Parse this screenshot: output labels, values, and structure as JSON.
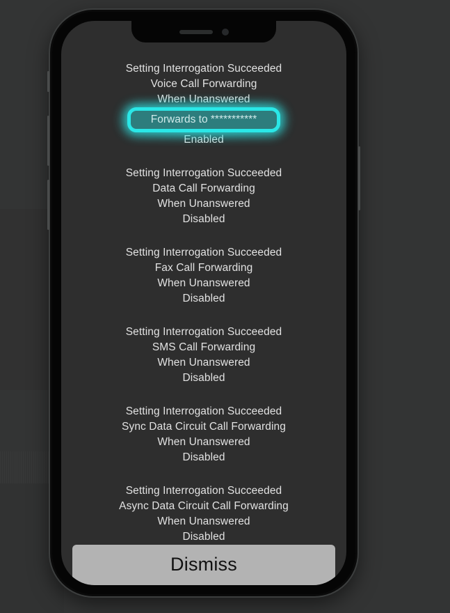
{
  "device": {
    "type": "smartphone",
    "notch": {
      "speaker": "earpiece-speaker",
      "camera": "front-camera"
    },
    "buttons": [
      "mute-switch",
      "volume-up",
      "volume-down",
      "power"
    ]
  },
  "alert": {
    "blocks": [
      {
        "title": "Setting Interrogation Succeeded",
        "service": "Voice Call Forwarding",
        "condition": "When Unanswered",
        "detail": "Forwards to ***********",
        "detail_label": "Forwards to",
        "detail_value": "***********",
        "status": "Enabled",
        "highlighted": true
      },
      {
        "title": "Setting Interrogation Succeeded",
        "service": "Data Call Forwarding",
        "condition": "When Unanswered",
        "status": "Disabled",
        "highlighted": false
      },
      {
        "title": "Setting Interrogation Succeeded",
        "service": "Fax Call Forwarding",
        "condition": "When Unanswered",
        "status": "Disabled",
        "highlighted": false
      },
      {
        "title": "Setting Interrogation Succeeded",
        "service": "SMS Call Forwarding",
        "condition": "When Unanswered",
        "status": "Disabled",
        "highlighted": false
      },
      {
        "title": "Setting Interrogation Succeeded",
        "service": "Sync Data Circuit Call Forwarding",
        "condition": "When Unanswered",
        "status": "Disabled",
        "highlighted": false
      },
      {
        "title": "Setting Interrogation Succeeded",
        "service": "Async Data Circuit Call Forwarding",
        "condition": "When Unanswered",
        "status": "Disabled",
        "highlighted": false
      }
    ],
    "dismiss_label": "Dismiss"
  },
  "colors": {
    "highlight_border": "#2ae7e7",
    "highlight_fill": "#2d7d7d",
    "screen_background": "#2e2e2e",
    "page_background": "#333434",
    "text": "#e2e2e2",
    "button_background": "#b3b3b3",
    "button_text": "#111111"
  }
}
